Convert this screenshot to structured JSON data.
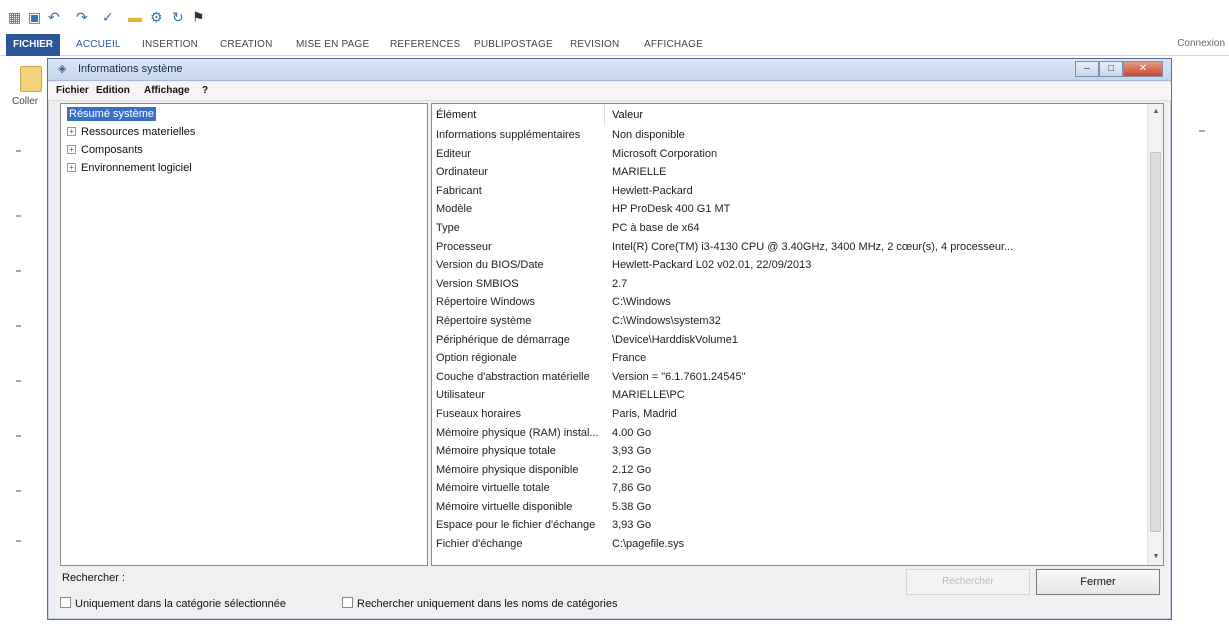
{
  "word": {
    "ribbon_tabs": [
      "ACCUEIL",
      "INSERTION",
      "CREATION",
      "MISE EN PAGE",
      "REFERENCES",
      "PUBLIPOSTAGE",
      "REVISION",
      "AFFICHAGE"
    ],
    "file_tab": "FICHIER",
    "connexion": "Connexion",
    "paste_label": "Coller"
  },
  "window": {
    "title": "Informations système",
    "menu": [
      "Fichier",
      "Edition",
      "Affichage",
      "?"
    ]
  },
  "tree": {
    "nodes": [
      {
        "label": "Résumé système",
        "selected": true,
        "expander": ""
      },
      {
        "label": "Ressources materielles",
        "expander": "+"
      },
      {
        "label": "Composants",
        "expander": "+"
      },
      {
        "label": "Environnement logiciel",
        "expander": "+"
      }
    ]
  },
  "list": {
    "headers": {
      "element": "Élément",
      "value": "Valeur"
    },
    "rows": [
      {
        "element": "Informations supplémentaires",
        "value": "Non disponible"
      },
      {
        "element": "Editeur",
        "value": "Microsoft Corporation"
      },
      {
        "element": "Ordinateur",
        "value": "MARIELLE"
      },
      {
        "element": "Fabricant",
        "value": "Hewlett-Packard"
      },
      {
        "element": "Modèle",
        "value": "HP ProDesk 400 G1 MT"
      },
      {
        "element": "Type",
        "value": "PC à base de x64"
      },
      {
        "element": "Processeur",
        "value": "Intel(R) Core(TM) i3-4130 CPU @ 3.40GHz, 3400 MHz, 2 cœur(s), 4 processeur..."
      },
      {
        "element": "Version du BIOS/Date",
        "value": "Hewlett-Packard L02 v02.01, 22/09/2013"
      },
      {
        "element": "Version SMBIOS",
        "value": "2.7"
      },
      {
        "element": "Répertoire Windows",
        "value": "C:\\Windows"
      },
      {
        "element": "Répertoire système",
        "value": "C:\\Windows\\system32"
      },
      {
        "element": "Périphérique de démarrage",
        "value": "\\Device\\HarddiskVolume1"
      },
      {
        "element": "Option régionale",
        "value": "France"
      },
      {
        "element": "Couche d'abstraction matérielle",
        "value": "Version = \"6.1.7601.24545\""
      },
      {
        "element": "Utilisateur",
        "value": "MARIELLE\\PC"
      },
      {
        "element": "Fuseaux horaires",
        "value": "Paris, Madrid"
      },
      {
        "element": "Mémoire physique (RAM) instal...",
        "value": "4.00 Go"
      },
      {
        "element": "Mémoire physique totale",
        "value": "3,93 Go"
      },
      {
        "element": "Mémoire physique disponible",
        "value": "2.12 Go"
      },
      {
        "element": "Mémoire virtuelle totale",
        "value": "7,86 Go"
      },
      {
        "element": "Mémoire virtuelle disponible",
        "value": "5.38 Go"
      },
      {
        "element": "Espace pour le fichier d'échange",
        "value": "3,93 Go"
      },
      {
        "element": "Fichier d'échange",
        "value": "C:\\pagefile.sys"
      }
    ]
  },
  "search": {
    "label": "Rechercher :",
    "search_button": "Rechercher",
    "close_button": "Fermer",
    "checkbox1": "Uniquement dans la catégorie sélectionnée",
    "checkbox2": "Rechercher uniquement dans les noms de catégories"
  },
  "colors": {
    "accent": "#2b579a",
    "selection": "#3b6fc5",
    "close": "#c84b2e"
  }
}
